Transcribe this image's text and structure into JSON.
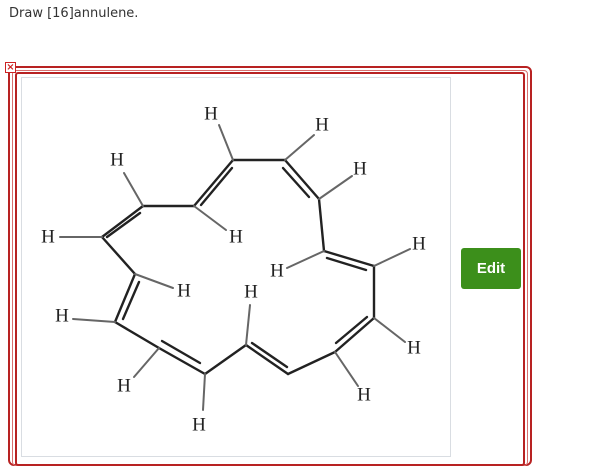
{
  "question": {
    "text": "Draw [16]annulene."
  },
  "editor": {
    "close_icon": "×",
    "edit_label": "Edit",
    "frame_color": "#b82222",
    "button_color": "#3c8f1b",
    "hydrogen_label": "H"
  }
}
